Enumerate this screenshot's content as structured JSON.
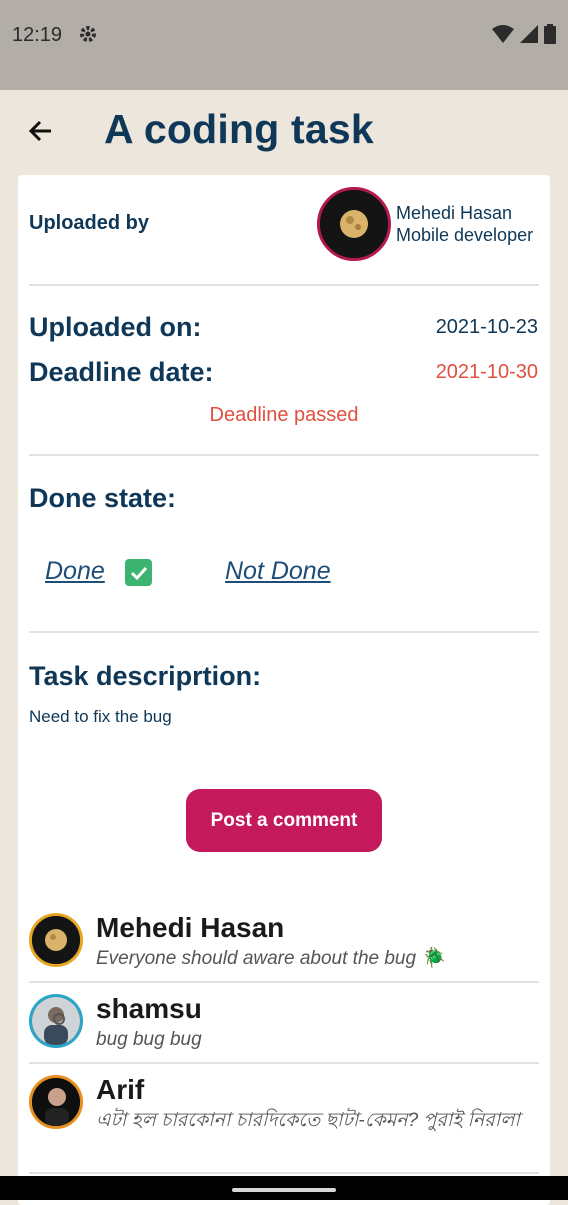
{
  "status_bar": {
    "time": "12:19",
    "icons": [
      "gear-icon",
      "wifi-icon",
      "signal-icon",
      "battery-icon"
    ]
  },
  "header": {
    "title": "A coding task",
    "back_icon": "arrow-left-icon"
  },
  "task": {
    "uploaded_by_label": "Uploaded by",
    "uploader_name": "Mehedi Hasan",
    "uploader_role": "Mobile developer",
    "uploaded_on_label": "Uploaded on:",
    "uploaded_on_value": "2021-10-23",
    "deadline_label": "Deadline date:",
    "deadline_value": "2021-10-30",
    "deadline_status": "Deadline passed",
    "done_state_label": "Done state:",
    "done_option": "Done",
    "done_checked": true,
    "not_done_option": "Not Done",
    "description_label": "Task descriprtion:",
    "description": "Need to fix the bug",
    "post_comment_button": "Post a comment"
  },
  "comments": [
    {
      "name": "Mehedi Hasan",
      "text": "Everyone should aware about the bug 🪲"
    },
    {
      "name": "shamsu",
      "text": "bug bug bug"
    },
    {
      "name": "Arif",
      "text": "এটা হল চারকোনা চারদিকেতে ছাটা-কেমন?  পুরাই নিরালা"
    }
  ],
  "colors": {
    "primary_text": "#0f3757",
    "accent_button": "#c41a5b",
    "deadline_red": "#e0503f",
    "check_green": "#3cb371",
    "background": "#ede6dc"
  }
}
